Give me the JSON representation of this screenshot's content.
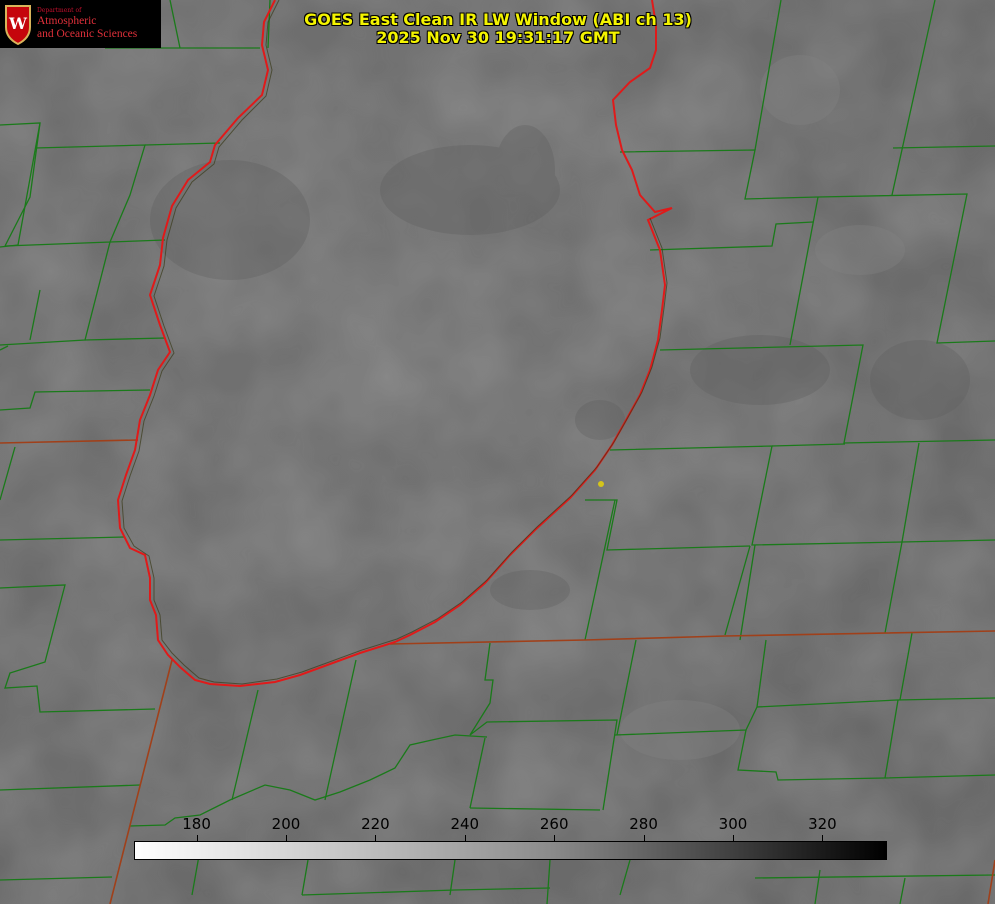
{
  "logo": {
    "department": "Department of",
    "line1": "Atmospheric",
    "line2": "and Oceanic Sciences",
    "crest_letter": "W"
  },
  "title": {
    "line1": "GOES East Clean IR LW Window (ABI ch 13)",
    "line2": "2025 Nov 30 19:31:17 GMT"
  },
  "colorbar": {
    "ticks": [
      "180",
      "200",
      "220",
      "240",
      "260",
      "280",
      "300",
      "320"
    ],
    "range_min": 166,
    "range_max": 334
  },
  "colors": {
    "title_text": "#f4f400",
    "county_lines": "#1a7a1a",
    "state_lines": "#a0401a",
    "lake_outline": "#e01a1a",
    "marker": "#d4c41a"
  }
}
